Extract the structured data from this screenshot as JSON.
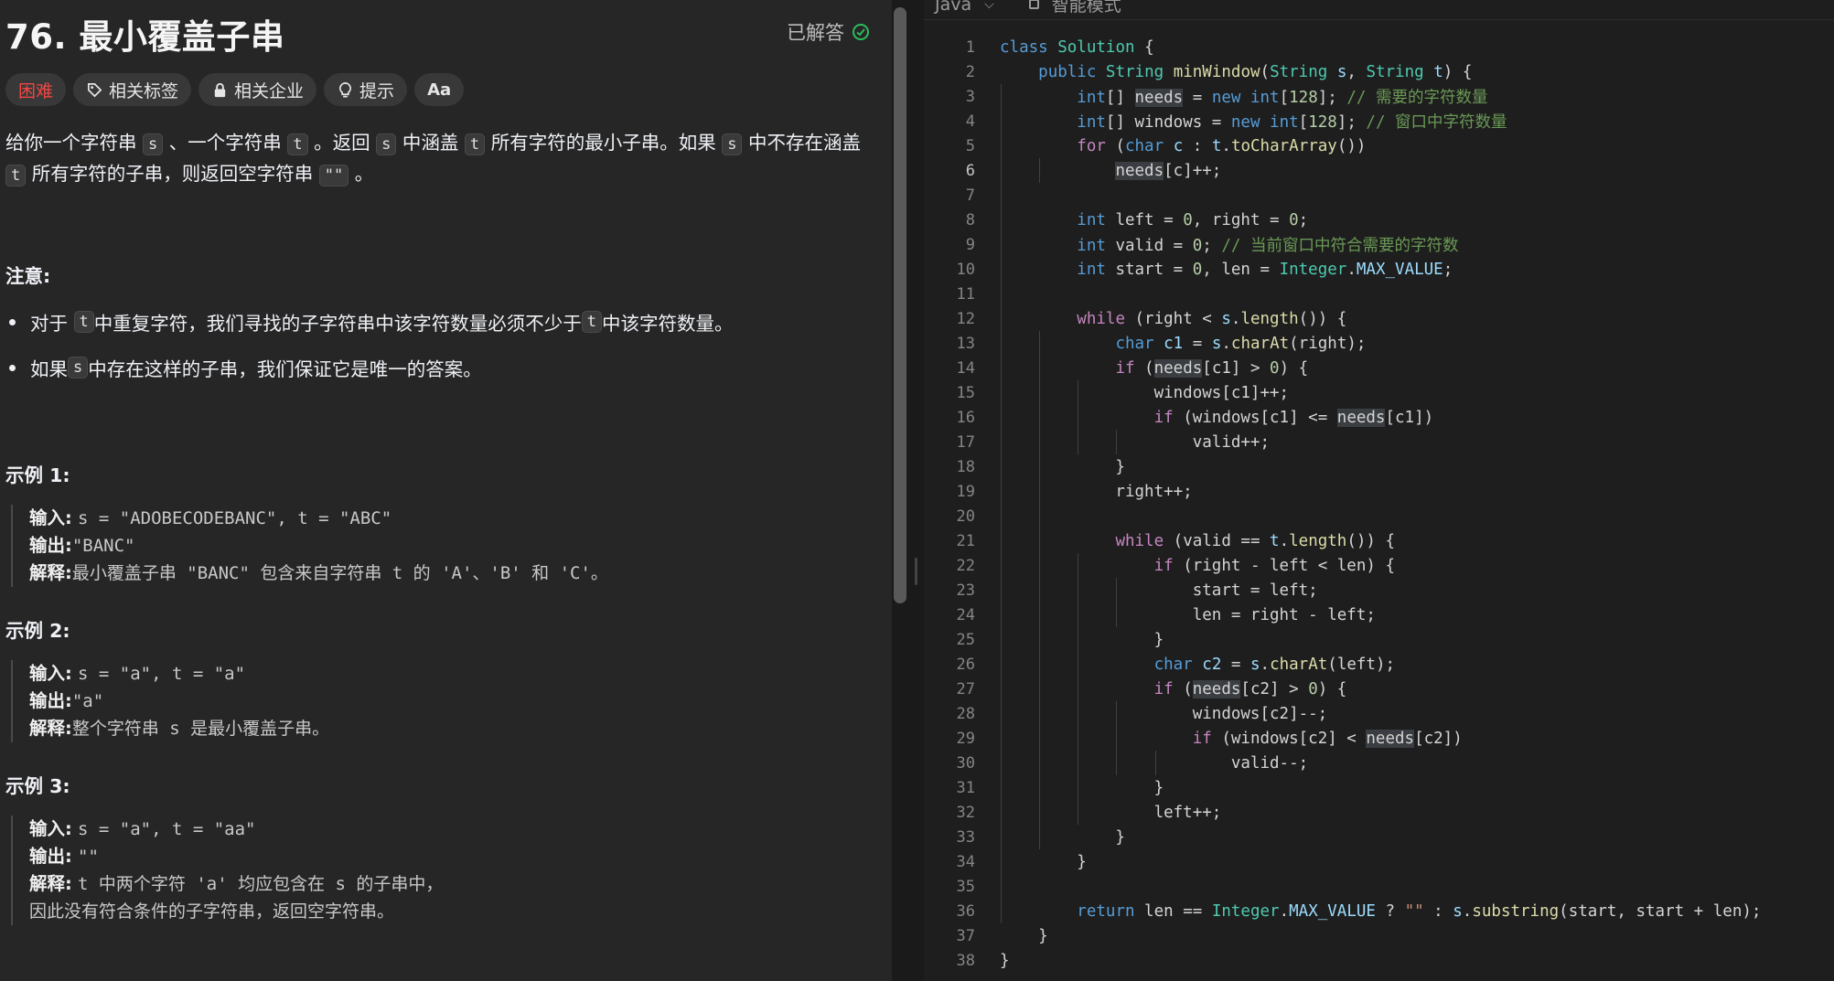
{
  "problem": {
    "title": "76. 最小覆盖子串",
    "status": "已解答",
    "tags": {
      "difficulty": "困难",
      "related_tags": "相关标签",
      "related_companies": "相关企业",
      "hint": "提示",
      "font_size": "Aа"
    },
    "desc": {
      "p1": "给你一个字符串 ",
      "s": "s",
      "p2": " 、一个字符串 ",
      "t": "t",
      "p3": " 。返回 ",
      "p4": " 中涵盖 ",
      "p5": " 所有字符的最小子串。如果 ",
      "p6": " 中不存在涵盖",
      "p7": " 所有字符的子串，则返回空字符串 ",
      "empty": "\"\"",
      "p8": " 。"
    },
    "note_heading": "注意:",
    "bullet1": {
      "a": "对于 ",
      "b": " 中重复字符，我们寻找的子字符串中该字符数量必须不少于 ",
      "c": " 中该字符数量。"
    },
    "bullet2": {
      "a": "如果 ",
      "b": " 中存在这样的子串，我们保证它是唯一的答案。"
    },
    "input_label": "输入:",
    "output_label": "输出:",
    "explain_label": "解释:",
    "examples": [
      {
        "heading": "示例 1:",
        "input": "s = \"ADOBECODEBANC\", t = \"ABC\"",
        "output": "\"BANC\"",
        "explain": "最小覆盖子串 \"BANC\" 包含来自字符串 t 的 'A'、'B' 和 'C'。"
      },
      {
        "heading": "示例 2:",
        "input": "s = \"a\", t = \"a\"",
        "output": "\"a\"",
        "explain": "整个字符串 s 是最小覆盖子串。"
      },
      {
        "heading": "示例 3:",
        "input": "s = \"a\", t = \"aa\"",
        "output": "\"\"",
        "explain": "t 中两个字符 'a' 均应包含在 s 的子串中，",
        "explain2": "因此没有符合条件的子字符串，返回空字符串。"
      }
    ]
  },
  "editor": {
    "language": "Java",
    "mode": "智能模式",
    "line_numbers": [
      "1",
      "2",
      "3",
      "4",
      "5",
      "6",
      "7",
      "8",
      "9",
      "10",
      "11",
      "12",
      "13",
      "14",
      "15",
      "16",
      "17",
      "18",
      "19",
      "20",
      "21",
      "22",
      "23",
      "24",
      "25",
      "26",
      "27",
      "28",
      "29",
      "30",
      "31",
      "32",
      "33",
      "34",
      "35",
      "36",
      "37",
      "38"
    ],
    "current_line": 6,
    "code": [
      "class Solution {",
      "    public String minWindow(String s, String t) {",
      "        int[] needs = new int[128]; // 需要的字符数量",
      "        int[] windows = new int[128]; // 窗口中字符数量",
      "        for (char c : t.toCharArray())",
      "            needs[c]++;",
      "",
      "        int left = 0, right = 0;",
      "        int valid = 0; // 当前窗口中符合需要的字符数",
      "        int start = 0, len = Integer.MAX_VALUE;",
      "",
      "        while (right < s.length()) {",
      "            char c1 = s.charAt(right);",
      "            if (needs[c1] > 0) {",
      "                windows[c1]++;",
      "                if (windows[c1] <= needs[c1])",
      "                    valid++;",
      "            }",
      "            right++;",
      "",
      "            while (valid == t.length()) {",
      "                if (right - left < len) {",
      "                    start = left;",
      "                    len = right - left;",
      "                }",
      "                char c2 = s.charAt(left);",
      "                if (needs[c2] > 0) {",
      "                    windows[c2]--;",
      "                    if (windows[c2] < needs[c2])",
      "                        valid--;",
      "                }",
      "                left++;",
      "            }",
      "        }",
      "",
      "        return len == Integer.MAX_VALUE ? \"\" : s.substring(start, start + len);",
      "    }",
      "}"
    ]
  },
  "colors": {
    "hard": "#ef4743",
    "solved_check": "#2cbb5d",
    "keyword": "#569cd6",
    "type": "#4ec9b0",
    "comment": "#6a9955"
  },
  "icons": [
    "check-circle-icon",
    "tag-icon",
    "lock-icon",
    "lightbulb-icon",
    "font-size-icon",
    "chevron-down-icon",
    "mode-box-icon"
  ]
}
